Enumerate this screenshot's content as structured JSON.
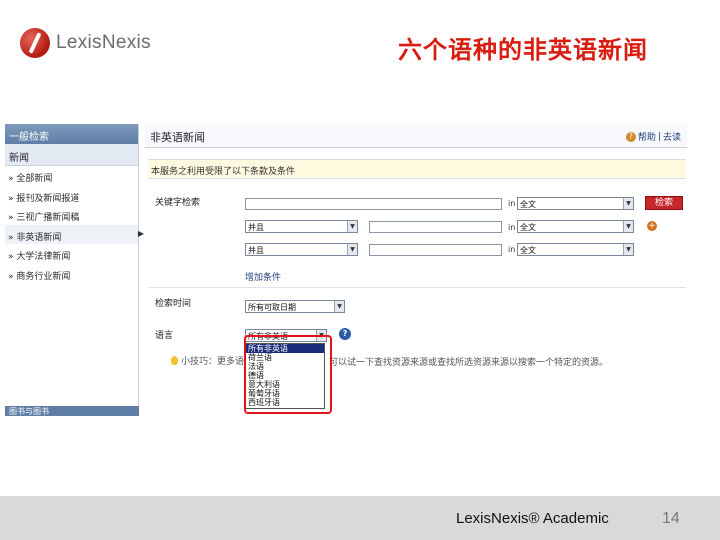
{
  "header": {
    "logo_text": "LexisNexis",
    "slide_title": "六个语种的非英语新闻"
  },
  "sidebar": {
    "top_label": "一般检索",
    "section_label": "新闻",
    "items": [
      {
        "label": "» 全部新闻"
      },
      {
        "label": "» 报刊及新闻报道"
      },
      {
        "label": "» 三视广播新闻稿"
      },
      {
        "label": "» 非英语新闻",
        "active": true
      },
      {
        "label": "» 大学法律新闻"
      },
      {
        "label": "» 商务行业新闻"
      }
    ],
    "bottom_label": "图书与图书"
  },
  "main": {
    "title": "非英语新闻",
    "help_label": "帮助",
    "close_label": "去读",
    "notice": "本服务之利用受限了以下条款及条件",
    "keyword_label": "关键字检索",
    "rows": [
      {
        "connector": "",
        "in": "in",
        "scope": "全文"
      },
      {
        "connector": "并且",
        "in": "in",
        "scope": "全文"
      },
      {
        "connector": "并且",
        "in": "in",
        "scope": "全文"
      }
    ],
    "search_button": "检索",
    "add_condition": "增加条件",
    "date_label": "检索时间",
    "date_value": "所有可取日期",
    "language_label": "语言",
    "language_value": "所有非英语",
    "language_options": [
      "所有非英语",
      "荷兰语",
      "法语",
      "德语",
      "意大利语",
      "葡萄牙语",
      "西班牙语"
    ],
    "language_highlight_index": 0,
    "tip_text": "小技巧：更多语",
    "tip_tail": "可以试一下查找资源来源或查找所选资源来源以搜索一个特定的资源。"
  },
  "footer": {
    "brand": "LexisNexis® Academic",
    "page_number": "14"
  },
  "colors": {
    "title_red": "#d81c10",
    "nav_blue": "#5f7ea6",
    "search_red": "#c7262a",
    "highlight_navy": "#1b2c7a"
  }
}
